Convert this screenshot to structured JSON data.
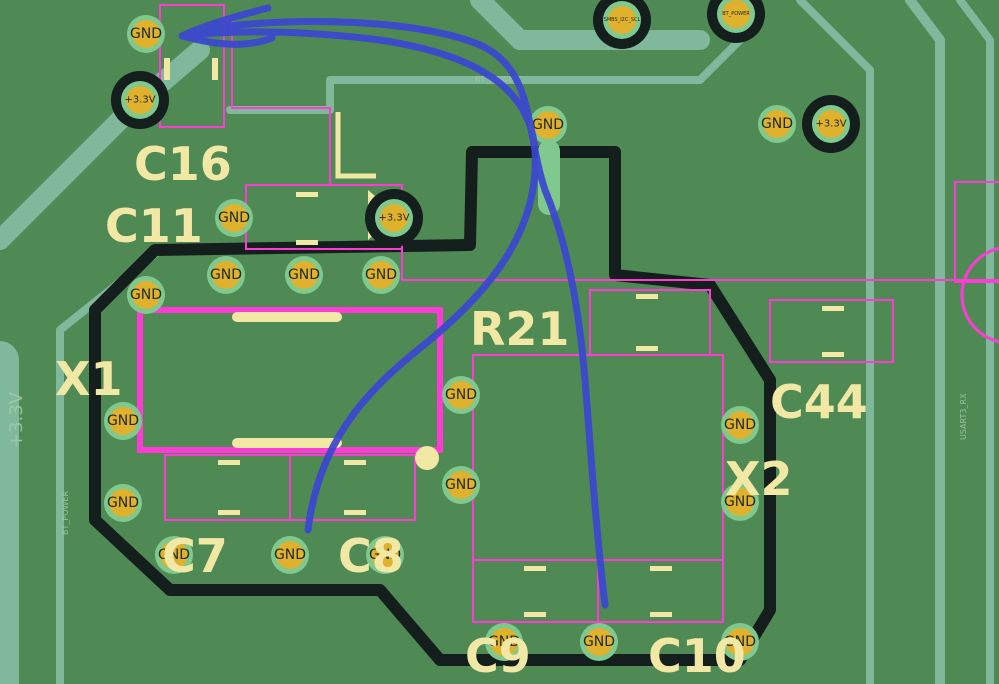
{
  "colors": {
    "board": "#4f8a55",
    "track": "#7fb89a",
    "zone_outline": "#141e1c",
    "courtyard": "#ff3bd6",
    "silkscreen": "#f2e8a5",
    "via_pad": "#e0b12c",
    "via_ring": "#7fc98f",
    "annotation": "#3b46d1"
  },
  "components": {
    "c16": "C16",
    "c11": "C11",
    "x1": "X1",
    "r21": "R21",
    "c44": "C44",
    "x2": "X2",
    "c7": "C7",
    "c8": "C8",
    "c9": "C9",
    "c10": "C10"
  },
  "nets": {
    "gnd": "GND",
    "v33": "+3.3V",
    "bt_power": "BT_POWER",
    "smbus": "SMBS_I2C_SCL",
    "usart": "USART3_RX",
    "v33_large": "+3.3V"
  }
}
